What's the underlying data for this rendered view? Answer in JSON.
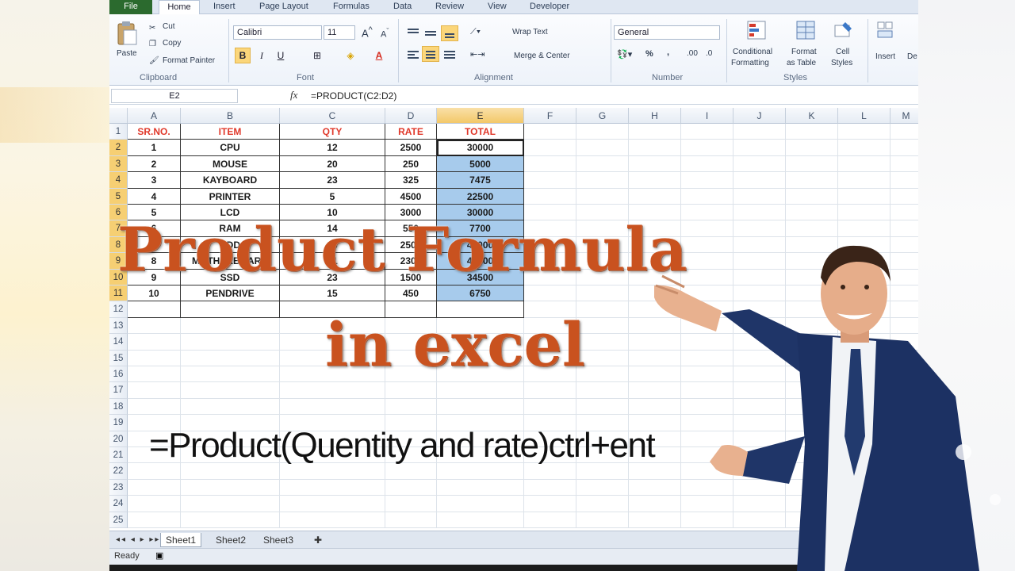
{
  "menu": {
    "tabs": [
      "File",
      "Home",
      "Insert",
      "Page Layout",
      "Formulas",
      "Data",
      "Review",
      "View",
      "Developer"
    ]
  },
  "ribbon": {
    "clipboard": {
      "paste": "Paste",
      "cut": "Cut",
      "copy": "Copy",
      "format_painter": "Format Painter",
      "label": "Clipboard"
    },
    "font": {
      "name": "Calibri",
      "size": "11",
      "label": "Font",
      "bold": "B",
      "italic": "I",
      "underline": "U"
    },
    "alignment": {
      "wrap_text": "Wrap Text",
      "merge_center": "Merge & Center",
      "label": "Alignment"
    },
    "number": {
      "format": "General",
      "percent": "%",
      "comma": ",",
      "label": "Number"
    },
    "styles": {
      "conditional": "Conditional",
      "formatting": "Formatting",
      "format": "Format",
      "as_table": "as Table",
      "cell": "Cell",
      "cell_styles": "Styles",
      "label": "Styles"
    },
    "cells": {
      "insert": "Insert",
      "delete": "De"
    }
  },
  "formula_bar": {
    "name_box": "E2",
    "fx": "fx",
    "formula": "=PRODUCT(C2:D2)"
  },
  "columns": [
    "A",
    "B",
    "C",
    "D",
    "E",
    "F",
    "G",
    "H",
    "I",
    "J",
    "K",
    "L",
    "M"
  ],
  "rows": [
    "1",
    "2",
    "3",
    "4",
    "5",
    "6",
    "7",
    "8",
    "9",
    "10",
    "11",
    "12",
    "13",
    "14",
    "15",
    "16",
    "17",
    "18",
    "19",
    "20",
    "21",
    "22",
    "23",
    "24",
    "25"
  ],
  "table": {
    "headers": [
      "SR.NO.",
      "ITEM",
      "QTY",
      "RATE",
      "TOTAL"
    ],
    "data": [
      [
        "1",
        "CPU",
        "12",
        "2500",
        "30000"
      ],
      [
        "2",
        "MOUSE",
        "20",
        "250",
        "5000"
      ],
      [
        "3",
        "KAYBOARD",
        "23",
        "325",
        "7475"
      ],
      [
        "4",
        "PRINTER",
        "5",
        "4500",
        "22500"
      ],
      [
        "5",
        "LCD",
        "10",
        "3000",
        "30000"
      ],
      [
        "6",
        "RAM",
        "14",
        "550",
        "7700"
      ],
      [
        "7",
        "HDD",
        "16",
        "2500",
        "40000"
      ],
      [
        "8",
        "MOTHERBOARD",
        "21",
        "2300",
        "48300"
      ],
      [
        "9",
        "SSD",
        "23",
        "1500",
        "34500"
      ],
      [
        "10",
        "PENDRIVE",
        "15",
        "450",
        "6750"
      ]
    ]
  },
  "sheets": [
    "Sheet1",
    "Sheet2",
    "Sheet3"
  ],
  "status": "Ready",
  "overlay": {
    "title_line1": "Product Formula",
    "title_line2": "in excel",
    "subtitle": "=Product(Quentity and rate)ctrl+ent"
  },
  "colors": {
    "accent_orange": "#c9521f",
    "header_red": "#e0382a",
    "selection_blue": "#a7cbec",
    "file_green": "#2b6a2e"
  }
}
